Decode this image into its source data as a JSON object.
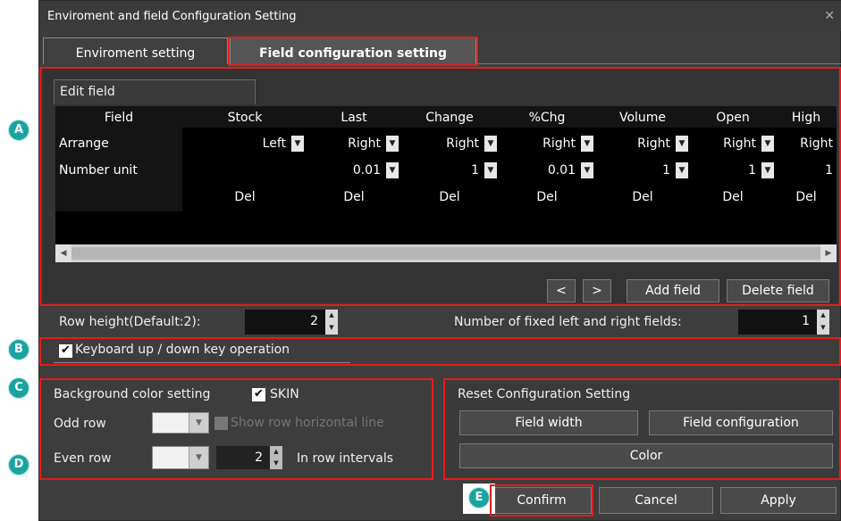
{
  "window": {
    "title": "Enviroment and field Configuration Setting",
    "close_glyph": "✕"
  },
  "tabs": [
    {
      "label": "Enviroment setting"
    },
    {
      "label": "Field configuration setting"
    }
  ],
  "markers": {
    "a": "A",
    "b": "B",
    "c": "C",
    "d": "D",
    "e": "E"
  },
  "edit_field": {
    "title": "Edit field",
    "columns": [
      "Field",
      "Stock",
      "Last",
      "Change",
      "%Chg",
      "Volume",
      "Open",
      "High"
    ],
    "rows": {
      "arrange": {
        "label": "Arrange",
        "values": [
          "Left",
          "Right",
          "Right",
          "Right",
          "Right",
          "Right",
          "Right"
        ]
      },
      "number_unit": {
        "label": "Number unit",
        "values": [
          "",
          "0.01",
          "1",
          "0.01",
          "1",
          "1",
          "1"
        ]
      },
      "delete": {
        "label": "",
        "values": [
          "Del",
          "Del",
          "Del",
          "Del",
          "Del",
          "Del",
          "Del"
        ]
      }
    },
    "buttons": {
      "prev": "<",
      "next": ">",
      "add": "Add field",
      "delete": "Delete field"
    }
  },
  "row_height": {
    "label": "Row height(Default:2):",
    "value": "2"
  },
  "fixed_fields": {
    "label": "Number of fixed left and right fields:",
    "value": "1"
  },
  "keyboard": {
    "label": "Keyboard up / down key operation",
    "checked": true
  },
  "background": {
    "title": "Background color setting",
    "skin_label": "SKIN",
    "odd_row_label": "Odd row",
    "even_row_label": "Even row",
    "show_line_label": "Show row horizontal line",
    "interval_value": "2",
    "interval_label": "In row intervals"
  },
  "reset": {
    "title": "Reset Configuration Setting",
    "field_width": "Field width",
    "field_configuration": "Field configuration",
    "color": "Color"
  },
  "footer": {
    "confirm": "Confirm",
    "cancel": "Cancel",
    "apply": "Apply"
  },
  "colors": {
    "accent_red": "#e61b1b",
    "marker_teal": "#1aa39f",
    "window_bg": "#3d3d3d"
  }
}
